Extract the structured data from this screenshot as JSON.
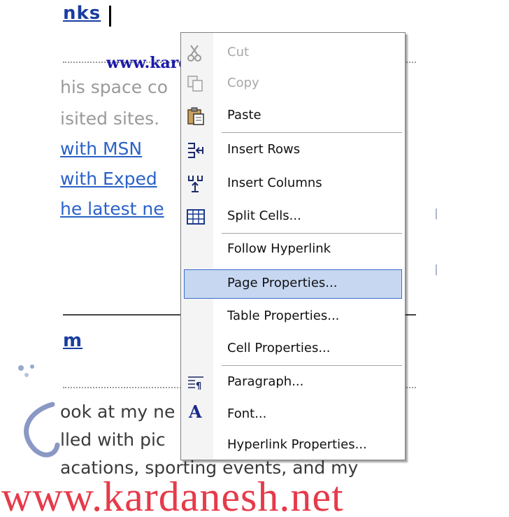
{
  "document": {
    "heading_links": "nks",
    "heading_album": "m",
    "line1": "his space co",
    "line2": "isited sites.",
    "link1": " with MSN",
    "link2": " with Exped",
    "link3": "he latest ne",
    "body1": "ook at my ne",
    "body2": "lled with pic",
    "body3": "acations, sporting events, and my"
  },
  "watermark": {
    "top": "www.kardanesh.com",
    "bottom": "www.kardanesh.net"
  },
  "context_menu": {
    "items": [
      {
        "label": "Cut",
        "icon": "scissors-icon",
        "enabled": false
      },
      {
        "label": "Copy",
        "icon": "copy-icon",
        "enabled": false
      },
      {
        "label": "Paste",
        "icon": "paste-icon",
        "enabled": true
      },
      {
        "label": "Insert Rows",
        "icon": "insert-rows-icon",
        "enabled": true
      },
      {
        "label": "Insert Columns",
        "icon": "insert-columns-icon",
        "enabled": true
      },
      {
        "label": "Split Cells...",
        "icon": "split-cells-icon",
        "enabled": true
      },
      {
        "label": "Follow Hyperlink",
        "icon": "",
        "enabled": true
      },
      {
        "label": "Page Properties...",
        "icon": "",
        "enabled": true,
        "highlighted": true
      },
      {
        "label": "Table Properties...",
        "icon": "",
        "enabled": true
      },
      {
        "label": "Cell Properties...",
        "icon": "",
        "enabled": true
      },
      {
        "label": "Paragraph...",
        "icon": "paragraph-icon",
        "enabled": true
      },
      {
        "label": "Font...",
        "icon": "font-icon",
        "enabled": true
      },
      {
        "label": "Hyperlink Properties...",
        "icon": "",
        "enabled": true
      }
    ]
  },
  "colors": {
    "highlight_bg": "#c7d7f2",
    "highlight_border": "#3a6ecb",
    "link": "#2a62c8",
    "watermark_red": "#e63a4a"
  }
}
